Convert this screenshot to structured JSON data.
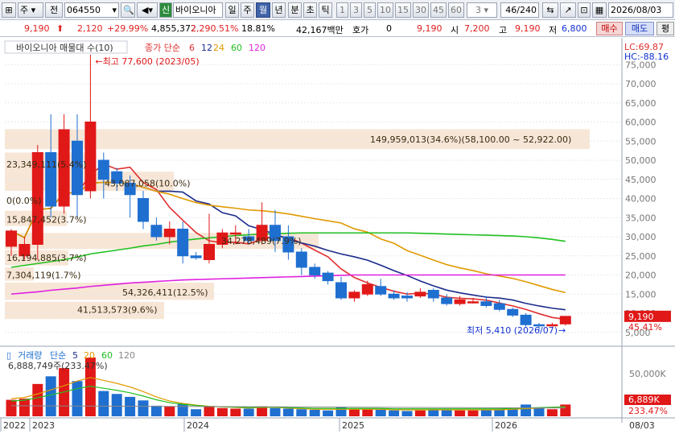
{
  "toolbar": {
    "mode": "주",
    "tab_prev": "전",
    "code": "064550",
    "sin_label": "신",
    "name": "바이오니아",
    "periods": [
      "일",
      "주",
      "월",
      "년",
      "분",
      "초",
      "틱"
    ],
    "active_period": "월",
    "minutes": [
      "1",
      "3",
      "5",
      "10",
      "15",
      "30",
      "45",
      "60"
    ],
    "custom_minute": "3",
    "view_count": "46",
    "view_total": "/240",
    "date": "2026/08/03"
  },
  "quote": {
    "price": "9,190",
    "arrow": "⬆",
    "change": "2,120",
    "change_pct": "+29.99%",
    "volume": "4,855,372",
    "vol_pct": "2,290.51%",
    "turnover_pct": "18.81%",
    "amount": "42,167백만",
    "hoga_label": "호가",
    "hoga_value": "0",
    "hoga_price": "9,190",
    "open_label": "시",
    "open": "7,200",
    "high_label": "고",
    "high": "9,190",
    "low_label": "저",
    "low": "6,800",
    "buy": "매수",
    "sell": "매도",
    "eval": "평"
  },
  "chart": {
    "legend_title": "바이오니아 매물대 수(10)",
    "legend_ma": "종가 단순",
    "ma_periods": [
      "6",
      "12",
      "24",
      "60",
      "120"
    ],
    "ma_colors": [
      "#e03030",
      "#1c2b8c",
      "#e09a00",
      "#20c020",
      "#e020e0"
    ],
    "lc": "LC:69.87",
    "hc": "HC:-88.16",
    "high_note": "←최고 77,600 (2023/05)",
    "low_note": "최저 5,410 (2026/07)",
    "low_arrow": "→",
    "price_tag": "9,190",
    "pct_tag": "45.41%",
    "yticks": [
      "75,000",
      "70,000",
      "65,000",
      "60,000",
      "55,000",
      "50,000",
      "45,000",
      "40,000",
      "35,000",
      "30,000",
      "25,000",
      "20,000",
      "15,000",
      "10,000",
      "5,000"
    ],
    "profile": [
      "149,959,013(34.6%)(58,100.00 ~ 52,922.00)",
      "23,349,111(5.4%)",
      "43,087,058(10.0%)",
      "0(0.0%)",
      "15,847,452(3.7%)",
      "34,278,489(7.9%)",
      "16,194,885(3.7%)",
      "7,304,119(1.7%)",
      "54,326,411(12.5%)",
      "41,513,573(9.6%)"
    ],
    "vol_legend": "거래량",
    "vol_ma_label": "단순",
    "vol_ma": [
      "5",
      "20",
      "60",
      "120"
    ],
    "vol_ma_colors": [
      "#1c2b8c",
      "#e09a00",
      "#20c020",
      "#888888"
    ],
    "vol_note": "6,888,749주(233.47%)",
    "vol_tick": "50,000K",
    "vol_tag": "6,889K",
    "vol_pct": "233.47%",
    "xlabels": [
      "2022",
      "2023",
      "2024",
      "2025",
      "2026"
    ],
    "xend": "08/03"
  },
  "chart_data": {
    "type": "candlestick",
    "period": "monthly",
    "unit": "KRW",
    "ylim": [
      2000,
      82000
    ],
    "candles": [
      [
        27500,
        31500,
        25000,
        32000
      ],
      [
        25000,
        28000,
        24000,
        30000
      ],
      [
        28000,
        52000,
        24000,
        54000
      ],
      [
        52000,
        38000,
        35000,
        62000
      ],
      [
        38000,
        58000,
        36000,
        62000
      ],
      [
        55000,
        41000,
        35000,
        62000
      ],
      [
        42000,
        60000,
        40000,
        77600
      ],
      [
        50000,
        45000,
        40000,
        52000
      ],
      [
        47000,
        44000,
        42000,
        48000
      ],
      [
        44000,
        41000,
        35000,
        46000
      ],
      [
        40000,
        34000,
        32000,
        42000
      ],
      [
        33000,
        30000,
        29000,
        35000
      ],
      [
        30000,
        32000,
        28000,
        34000
      ],
      [
        32000,
        25000,
        23000,
        34000
      ],
      [
        25000,
        24500,
        24000,
        26000
      ],
      [
        24000,
        28000,
        23000,
        36000
      ],
      [
        28000,
        31000,
        27000,
        32000
      ],
      [
        31000,
        31000,
        28000,
        33000
      ],
      [
        30000,
        29000,
        28000,
        32000
      ],
      [
        29000,
        33000,
        28000,
        39000
      ],
      [
        33000,
        29000,
        26000,
        37000
      ],
      [
        30000,
        26000,
        24000,
        33000
      ],
      [
        26000,
        22000,
        20000,
        27000
      ],
      [
        22000,
        20000,
        19000,
        23000
      ],
      [
        20500,
        18500,
        17500,
        21000
      ],
      [
        18000,
        14000,
        13500,
        19500
      ],
      [
        14000,
        15500,
        13000,
        16000
      ],
      [
        15000,
        17500,
        14500,
        18500
      ],
      [
        17000,
        15000,
        14500,
        19000
      ],
      [
        15000,
        14000,
        13500,
        16000
      ],
      [
        14500,
        14000,
        13000,
        15500
      ],
      [
        14500,
        15500,
        14000,
        16500
      ],
      [
        16000,
        14000,
        13000,
        16500
      ],
      [
        14000,
        12500,
        12000,
        15000
      ],
      [
        12500,
        13500,
        12000,
        14500
      ],
      [
        13000,
        13000,
        12500,
        14000
      ],
      [
        13000,
        12000,
        11500,
        14500
      ],
      [
        12500,
        11000,
        10500,
        13500
      ],
      [
        11000,
        9500,
        9000,
        11500
      ],
      [
        9500,
        7000,
        6500,
        10000
      ],
      [
        7000,
        6800,
        5410,
        7500
      ],
      [
        6800,
        7000,
        6500,
        7500
      ],
      [
        7200,
        9190,
        6800,
        9190
      ]
    ],
    "volume_relative": [
      0.28,
      0.3,
      0.55,
      0.68,
      0.82,
      0.6,
      1.0,
      0.43,
      0.38,
      0.33,
      0.27,
      0.18,
      0.17,
      0.22,
      0.12,
      0.17,
      0.14,
      0.13,
      0.13,
      0.17,
      0.14,
      0.13,
      0.12,
      0.11,
      0.1,
      0.16,
      0.12,
      0.12,
      0.11,
      0.1,
      0.09,
      0.1,
      0.12,
      0.11,
      0.1,
      0.1,
      0.11,
      0.12,
      0.15,
      0.2,
      0.14,
      0.12,
      0.2
    ]
  }
}
